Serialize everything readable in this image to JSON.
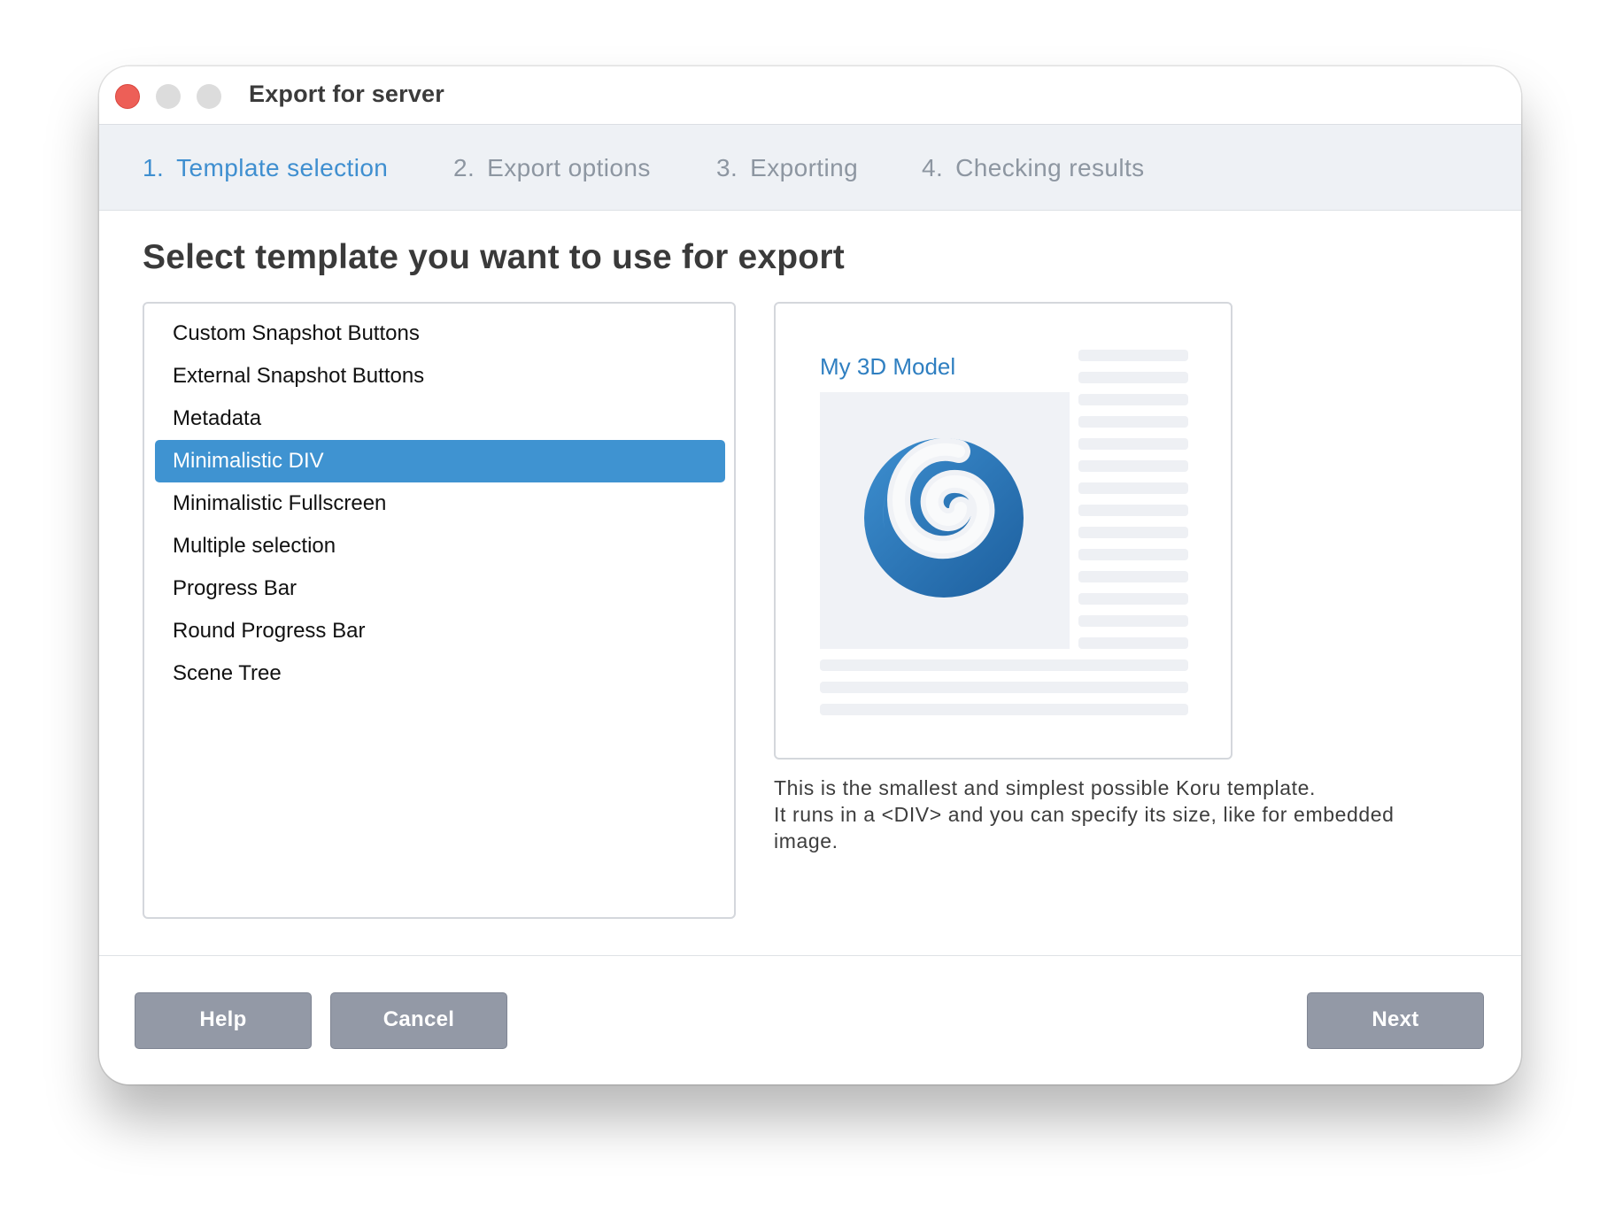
{
  "window": {
    "title": "Export for server"
  },
  "steps": [
    {
      "num": "1.",
      "label": "Template selection",
      "active": true
    },
    {
      "num": "2.",
      "label": "Export options",
      "active": false
    },
    {
      "num": "3.",
      "label": "Exporting",
      "active": false
    },
    {
      "num": "4.",
      "label": "Checking results",
      "active": false
    }
  ],
  "main": {
    "heading": "Select template you want to use for export",
    "templates": [
      "Custom Snapshot Buttons",
      "External Snapshot Buttons",
      "Metadata",
      "Minimalistic DIV",
      "Minimalistic Fullscreen",
      "Multiple selection",
      "Progress Bar",
      "Round Progress Bar",
      "Scene Tree"
    ],
    "selected_template": "Minimalistic DIV",
    "preview": {
      "title": "My 3D Model",
      "logo_icon": "koru-spiral-icon"
    },
    "description": [
      "This is the smallest and simplest possible Koru template.",
      "It runs in a <DIV> and you can specify its size, like for embedded",
      "image."
    ]
  },
  "footer": {
    "help_label": "Help",
    "cancel_label": "Cancel",
    "next_label": "Next"
  },
  "colors": {
    "accent": "#3f93d1",
    "step_active": "#3f8fd0",
    "step_inactive": "#8d96a1",
    "button_bg": "#9399a6",
    "close_light": "#ed5f57"
  }
}
